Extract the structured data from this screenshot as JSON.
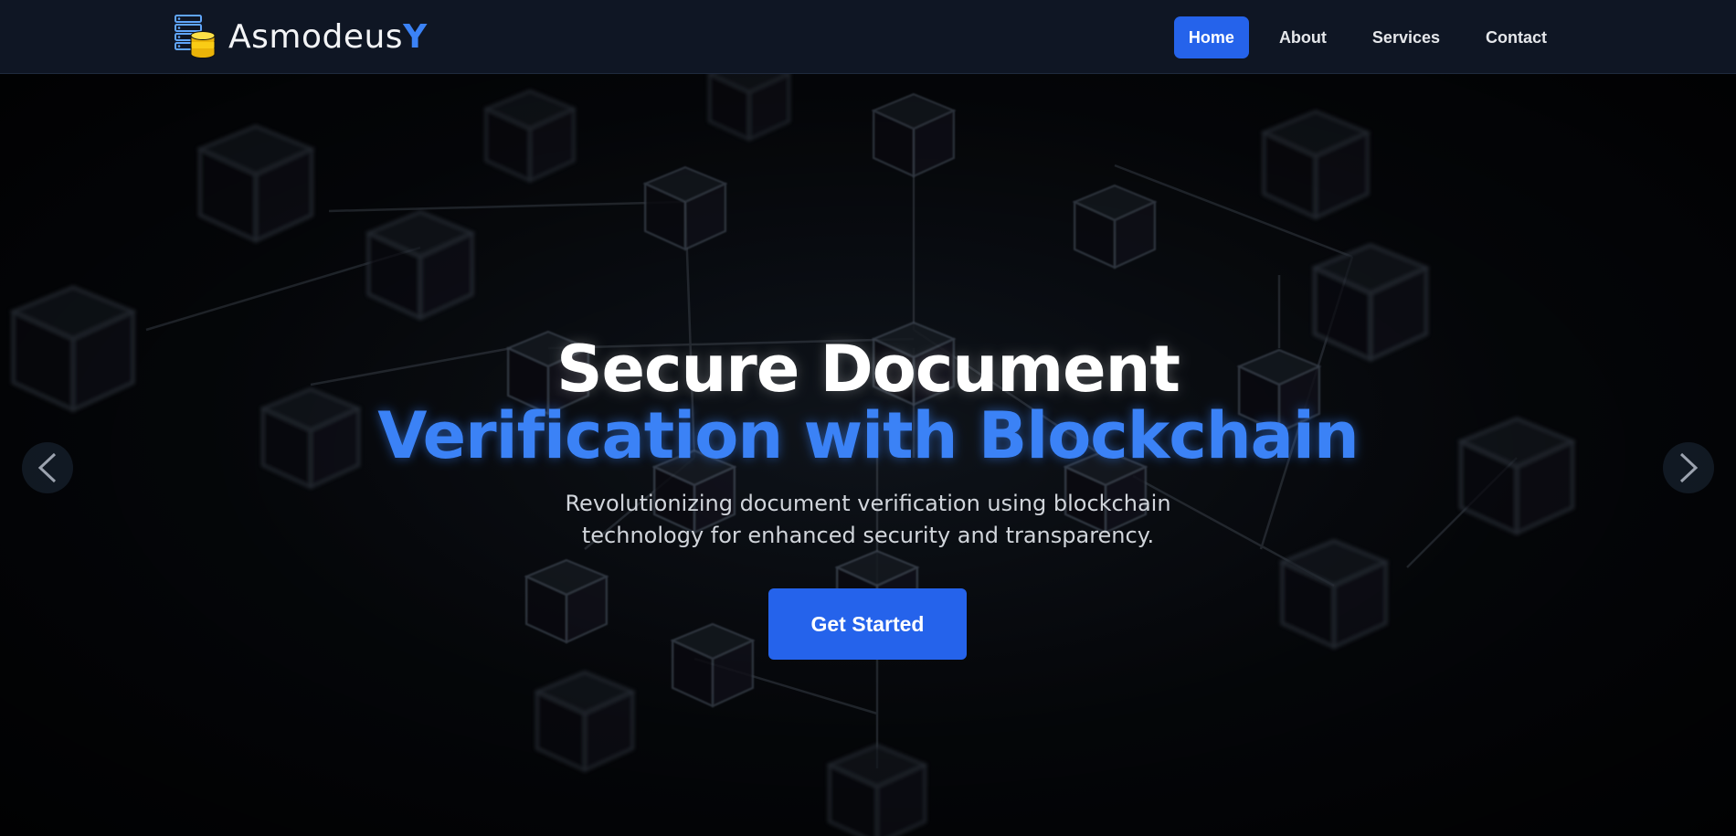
{
  "brand": {
    "name_main": "Asmodeus",
    "name_accent": "Y",
    "icon": "database-server-icon"
  },
  "nav": {
    "items": [
      {
        "label": "Home",
        "active": true
      },
      {
        "label": "About",
        "active": false
      },
      {
        "label": "Services",
        "active": false
      },
      {
        "label": "Contact",
        "active": false
      }
    ]
  },
  "hero": {
    "title_line1": "Secure Document",
    "title_line2": "Verification with Blockchain",
    "subtitle": "Revolutionizing document verification using blockchain technology for enhanced security and transparency.",
    "cta_label": "Get Started",
    "prev_icon": "chevron-left-icon",
    "next_icon": "chevron-right-icon",
    "background": "blockchain-cubes-network"
  },
  "colors": {
    "accent": "#3b82f6",
    "button": "#2563eb",
    "navbar_bg": "#0f1624",
    "hero_bg": "#05070b"
  }
}
